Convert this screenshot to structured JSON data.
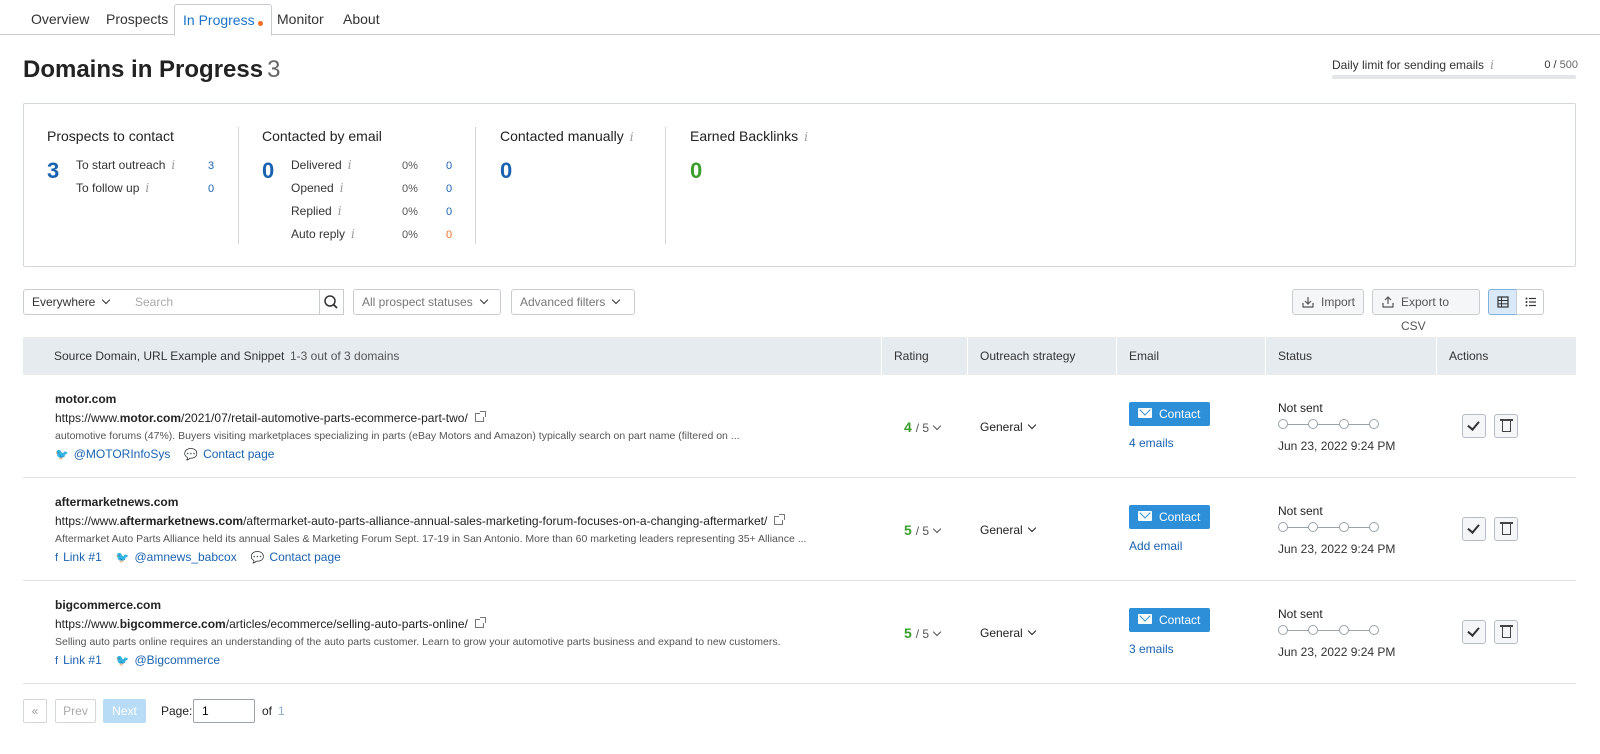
{
  "tabs": [
    "Overview",
    "Prospects",
    "In Progress",
    "Monitor",
    "About"
  ],
  "header": {
    "title": "Domains in Progress",
    "count": "3",
    "limit_label": "Daily limit for sending emails",
    "limit_used": "0",
    "limit_total": "500",
    "limit_progress": 0
  },
  "summary": {
    "prospects": {
      "title": "Prospects to contact",
      "total": "3",
      "rows": [
        {
          "label": "To start outreach",
          "value": "3"
        },
        {
          "label": "To follow up",
          "value": "0"
        }
      ]
    },
    "email": {
      "title": "Contacted by email",
      "total": "0",
      "rows": [
        {
          "label": "Delivered",
          "pct": "0%",
          "value": "0"
        },
        {
          "label": "Opened",
          "pct": "0%",
          "value": "0"
        },
        {
          "label": "Replied",
          "pct": "0%",
          "value": "0"
        },
        {
          "label": "Auto reply",
          "pct": "0%",
          "value": "0"
        }
      ]
    },
    "manual": {
      "title": "Contacted manually",
      "total": "0"
    },
    "backlinks": {
      "title": "Earned Backlinks",
      "total": "0"
    }
  },
  "toolbar": {
    "scope": "Everywhere",
    "search_placeholder": "Search",
    "statuses": "All prospect statuses",
    "filters": "Advanced filters",
    "import": "Import",
    "export": "Export to CSV"
  },
  "table": {
    "headers": {
      "source": "Source Domain, URL Example and Snippet",
      "count": "1-3 out of 3 domains",
      "rating": "Rating",
      "strategy": "Outreach strategy",
      "email": "Email",
      "status": "Status",
      "actions": "Actions"
    },
    "rows": [
      {
        "domain": "motor.com",
        "url_prefix": "https://www.",
        "url_bold": "motor.com",
        "url_rest": "/2021/07/retail-automotive-parts-ecommerce-part-two/",
        "snippet": "automotive forums (47%). Buyers visiting marketplaces specializing in parts (eBay Motors and Amazon) typically search on part name (filtered on ...",
        "links": [
          {
            "icon": "twitter-icon",
            "glyph": "🐦",
            "text": "@MOTORInfoSys"
          },
          {
            "icon": "comment-icon",
            "glyph": "💬",
            "text": "Contact page"
          }
        ],
        "rating": "4",
        "rating_max": "/ 5",
        "strategy": "General",
        "contact": "Contact",
        "email_link": "4 emails",
        "status": "Not sent",
        "date": "Jun 23, 2022 9:24 PM"
      },
      {
        "domain": "aftermarketnews.com",
        "url_prefix": "https://www.",
        "url_bold": "aftermarketnews.com",
        "url_rest": "/aftermarket-auto-parts-alliance-annual-sales-marketing-forum-focuses-on-a-changing-aftermarket/",
        "snippet": "Aftermarket Auto Parts Alliance held its annual Sales & Marketing Forum Sept. 17-19 in San Antonio. More than 60 marketing leaders representing 35+ Alliance ...",
        "links": [
          {
            "icon": "facebook-icon",
            "glyph": "f",
            "text": "Link #1"
          },
          {
            "icon": "twitter-icon",
            "glyph": "🐦",
            "text": "@amnews_babcox"
          },
          {
            "icon": "comment-icon",
            "glyph": "💬",
            "text": "Contact page"
          }
        ],
        "rating": "5",
        "rating_max": "/ 5",
        "strategy": "General",
        "contact": "Contact",
        "email_link": "Add email",
        "status": "Not sent",
        "date": "Jun 23, 2022 9:24 PM"
      },
      {
        "domain": "bigcommerce.com",
        "url_prefix": "https://www.",
        "url_bold": "bigcommerce.com",
        "url_rest": "/articles/ecommerce/selling-auto-parts-online/",
        "snippet": "Selling auto parts online requires an understanding of the auto parts customer. Learn to grow your automotive parts business and expand to new customers.",
        "links": [
          {
            "icon": "facebook-icon",
            "glyph": "f",
            "text": "Link #1"
          },
          {
            "icon": "twitter-icon",
            "glyph": "🐦",
            "text": "@Bigcommerce"
          }
        ],
        "rating": "5",
        "rating_max": "/ 5",
        "strategy": "General",
        "contact": "Contact",
        "email_link": "3 emails",
        "status": "Not sent",
        "date": "Jun 23, 2022 9:24 PM"
      }
    ]
  },
  "pagination": {
    "first": "«",
    "prev": "Prev",
    "next": "Next",
    "page_label": "Page:",
    "page": "1",
    "of_label": "of",
    "total": "1"
  },
  "colors": {
    "accent": "#2d8fd8",
    "link": "#1a63b0",
    "green": "#3a9e2c",
    "orange": "#f26d21"
  }
}
